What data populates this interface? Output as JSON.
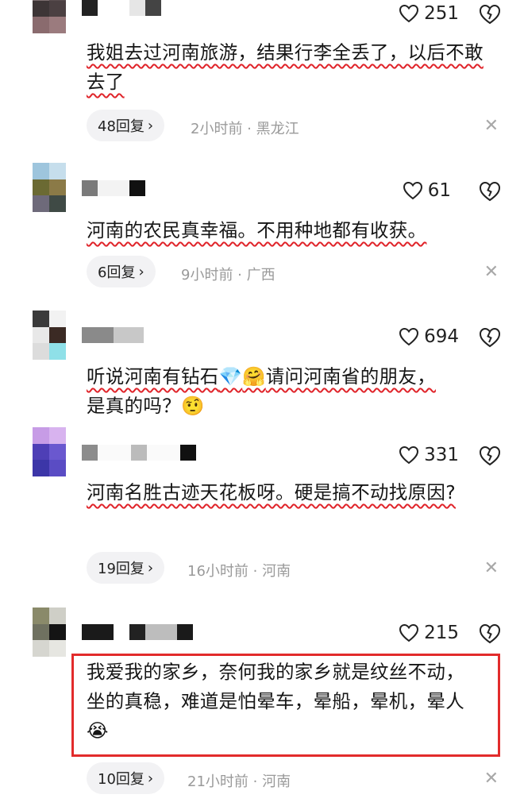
{
  "comments": [
    {
      "likes": "251",
      "text": "我姐去过河南旅游，结果行李全丢了，以后不敢去了",
      "replies": "48回复",
      "meta": "2小时前 · 黑龙江"
    },
    {
      "likes": "61",
      "text": "河南的农民真幸福。不用种地都有收获。",
      "replies": "6回复",
      "meta": "9小时前 · 广西"
    },
    {
      "likes": "694",
      "text_a": "听说河南有钻石",
      "text_b": "请问河南省的朋友，",
      "text_c": "是真的吗？"
    },
    {
      "likes": "331",
      "text": "河南名胜古迹天花板呀。硬是搞不动找原因?",
      "replies": "19回复",
      "meta": "16小时前 · 河南"
    },
    {
      "likes": "215",
      "text": "我爱我的家乡，奈何我的家乡就是纹丝不动，坐的真稳，难道是怕晕车，晕船，晕机，晕人",
      "replies": "10回复",
      "meta": "21小时前 · 河南"
    }
  ],
  "icons": {
    "like": "heart-outline-icon",
    "dislike": "broken-heart-icon",
    "reply_arrow": "chevron-right-icon",
    "close": "close-icon",
    "emoji_diamond": "gem-emoji",
    "emoji_hug": "hugging-face-emoji",
    "emoji_think": "skeptical-face-emoji",
    "emoji_cry": "crying-face-emoji"
  },
  "colors": {
    "highlight_underline": "#e0242a",
    "highlight_box": "#e22b2b",
    "meta_text": "#9a9a9a",
    "reply_bg": "#f2f2f4"
  }
}
